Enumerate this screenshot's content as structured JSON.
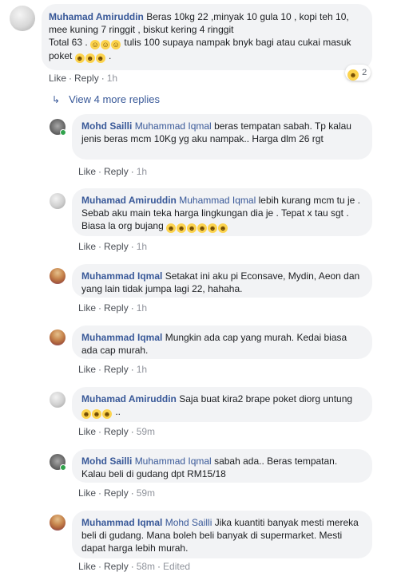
{
  "top_comment": {
    "author": "Muhamad Amiruddin",
    "text1": "Beras 10kg 22 ,minyak 10 gula 10 , kopi teh 10, mee kuning 7 ringgit , biskut kering 4 ringgit",
    "text2": "Total 63 .",
    "text3": "tulis 100 supaya nampak bnyk bagi atau cukai masuk poket",
    "text4": ".",
    "like": "Like",
    "reply": "Reply",
    "time": "1h",
    "reaction_count": "2",
    "reaction_icon": "laugh-emoji"
  },
  "view_more": {
    "label": "View 4 more replies",
    "icon": "reply-arrow-icon"
  },
  "replies": [
    {
      "author": "Mohd Sailli",
      "mention": "Muhammad Iqmal",
      "text": "beras tempatan sabah. Tp kalau jenis beras mcm 10Kg yg aku nampak.. Harga dlm 26 rgt",
      "like": "Like",
      "reply": "Reply",
      "time": "1h"
    },
    {
      "author": "Muhamad Amiruddin",
      "mention": "Muhammad Iqmal",
      "text": "lebih kurang mcm tu je . Sebab aku main teka harga lingkungan dia je . Tepat x tau sgt . Biasa la org bujang",
      "like": "Like",
      "reply": "Reply",
      "time": "1h"
    },
    {
      "author": "Muhammad Iqmal",
      "mention": "",
      "text": "Setakat ini aku pi Econsave, Mydin, Aeon dan yang lain tidak jumpa lagi 22, hahaha.",
      "like": "Like",
      "reply": "Reply",
      "time": "1h"
    },
    {
      "author": "Muhammad Iqmal",
      "mention": "",
      "text": "Mungkin ada cap yang murah. Kedai biasa ada cap murah.",
      "like": "Like",
      "reply": "Reply",
      "time": "1h"
    },
    {
      "author": "Muhamad Amiruddin",
      "mention": "",
      "text": "Saja buat kira2 brape poket diorg untung",
      "text_end": "..",
      "like": "Like",
      "reply": "Reply",
      "time": "59m"
    },
    {
      "author": "Mohd Sailli",
      "mention": "Muhammad Iqmal",
      "text": "sabah ada.. Beras tempatan. Kalau beli di gudang dpt RM15/18",
      "like": "Like",
      "reply": "Reply",
      "time": "59m"
    },
    {
      "author": "Muhammad Iqmal",
      "mention": "Mohd Sailli",
      "text": "Jika kuantiti banyak mesti mereka beli di gudang. Mana boleh beli banyak di supermarket. Mesti dapat harga lebih murah.",
      "like": "Like",
      "reply": "Reply",
      "time": "58m",
      "edited": "Edited"
    }
  ],
  "emoji": {
    "smile": "☺",
    "laugh": "☻",
    "rofl": "☻"
  },
  "colors": {
    "link_blue": "#385898",
    "bubble_bg": "#f2f3f5",
    "meta_gray": "#606770",
    "online_green": "#31a24c"
  }
}
